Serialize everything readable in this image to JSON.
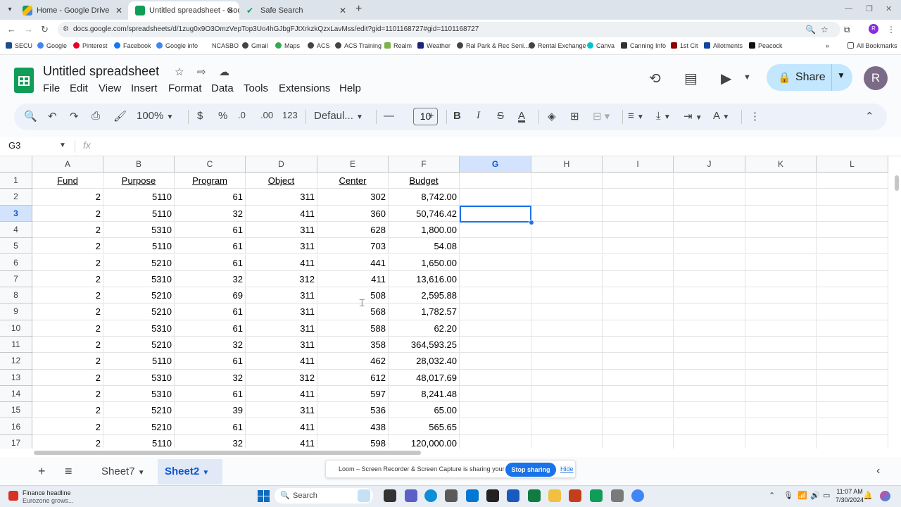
{
  "browser": {
    "tabs": [
      {
        "title": "Home - Google Drive",
        "active": false
      },
      {
        "title": "Untitled spreadsheet - Google",
        "active": true
      },
      {
        "title": "Safe Search",
        "active": false
      }
    ],
    "url": "docs.google.com/spreadsheets/d/1zug0x9O3OmzVepTop3Uo4hGJbgFJtXrkzkQzxLavMss/edit?gid=1101168727#gid=1101168727",
    "bookmarks": [
      "SECU",
      "Google",
      "Pinterest",
      "Facebook",
      "Google info",
      "NCASBO",
      "Gmail",
      "Maps",
      "ACS",
      "ACS Training",
      "Realm",
      "Weather",
      "Ral Park & Rec Seni...",
      "Rental Exchange",
      "Canva",
      "Canning Info",
      "1st Cit",
      "Allotments",
      "Peacock"
    ],
    "all_bookmarks": "All Bookmarks",
    "profile_initial": "R"
  },
  "sheets": {
    "title": "Untitled spreadsheet",
    "menu": [
      "File",
      "Edit",
      "View",
      "Insert",
      "Format",
      "Data",
      "Tools",
      "Extensions",
      "Help"
    ],
    "share_label": "Share",
    "avatar_initial": "R",
    "toolbar": {
      "zoom": "100%",
      "currency": "$",
      "percent": "%",
      "dec_decrease": ".0",
      "dec_increase": ".00",
      "number_format": "123",
      "font": "Defaul...",
      "font_size": "10"
    },
    "name_box": "G3",
    "fx": "fx"
  },
  "grid": {
    "columns": [
      "A",
      "B",
      "C",
      "D",
      "E",
      "F",
      "G",
      "H",
      "I",
      "J",
      "K",
      "L"
    ],
    "selected_column": "G",
    "selected_row": "3",
    "row_numbers": [
      "1",
      "2",
      "3",
      "4",
      "5",
      "6",
      "7",
      "8",
      "9",
      "10",
      "11",
      "12",
      "13",
      "14",
      "15",
      "16",
      "17"
    ],
    "headers": [
      "Fund",
      "Purpose",
      "Program",
      "Object",
      "Center",
      "Budget"
    ],
    "rows": [
      [
        "2",
        "5110",
        "61",
        "311",
        "302",
        "8,742.00"
      ],
      [
        "2",
        "5110",
        "32",
        "411",
        "360",
        "50,746.42"
      ],
      [
        "2",
        "5310",
        "61",
        "311",
        "628",
        "1,800.00"
      ],
      [
        "2",
        "5110",
        "61",
        "311",
        "703",
        "54.08"
      ],
      [
        "2",
        "5210",
        "61",
        "411",
        "441",
        "1,650.00"
      ],
      [
        "2",
        "5310",
        "32",
        "312",
        "411",
        "13,616.00"
      ],
      [
        "2",
        "5210",
        "69",
        "311",
        "508",
        "2,595.88"
      ],
      [
        "2",
        "5210",
        "61",
        "311",
        "568",
        "1,782.57"
      ],
      [
        "2",
        "5310",
        "61",
        "311",
        "588",
        "62.20"
      ],
      [
        "2",
        "5210",
        "32",
        "311",
        "358",
        "364,593.25"
      ],
      [
        "2",
        "5110",
        "61",
        "411",
        "462",
        "28,032.40"
      ],
      [
        "2",
        "5310",
        "32",
        "312",
        "612",
        "48,017.69"
      ],
      [
        "2",
        "5310",
        "61",
        "411",
        "597",
        "8,241.48"
      ],
      [
        "2",
        "5210",
        "39",
        "311",
        "536",
        "65.00"
      ],
      [
        "2",
        "5210",
        "61",
        "411",
        "438",
        "565.65"
      ],
      [
        "2",
        "5110",
        "32",
        "411",
        "598",
        "120,000.00"
      ]
    ]
  },
  "sheet_tabs": [
    {
      "name": "Sheet7",
      "active": false
    },
    {
      "name": "Sheet2",
      "active": true
    }
  ],
  "loom": {
    "message": "Loom – Screen Recorder & Screen Capture is sharing your screen.",
    "stop": "Stop sharing",
    "hide": "Hide"
  },
  "taskbar": {
    "news_title": "Finance headline",
    "news_sub": "Eurozone grows...",
    "search": "Search",
    "time": "11:07 AM",
    "date": "7/30/2024"
  },
  "colors": {
    "accent": "#1a73e8",
    "sheets_green": "#0f9d58",
    "share_bg": "#c2e7ff",
    "selection_header": "#d3e3fd"
  }
}
